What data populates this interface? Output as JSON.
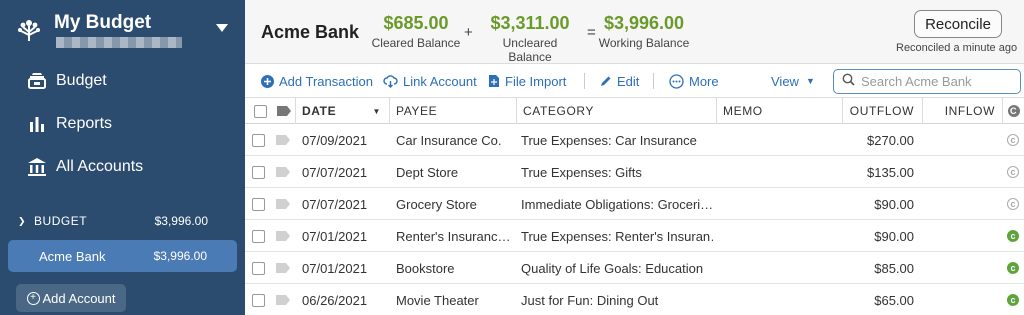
{
  "sidebar": {
    "budget_name": "My Budget",
    "nav": [
      {
        "label": "Budget",
        "icon": "wallet-icon"
      },
      {
        "label": "Reports",
        "icon": "bar-chart-icon"
      },
      {
        "label": "All Accounts",
        "icon": "bank-icon"
      }
    ],
    "group": {
      "label": "BUDGET",
      "amount": "$3,996.00"
    },
    "account": {
      "name": "Acme Bank",
      "amount": "$3,996.00"
    },
    "add_account_label": "Add Account"
  },
  "header": {
    "account_name": "Acme Bank",
    "cleared": {
      "value": "$685.00",
      "label": "Cleared Balance"
    },
    "uncleared": {
      "value": "$3,311.00",
      "label": "Uncleared Balance"
    },
    "working": {
      "value": "$3,996.00",
      "label": "Working Balance"
    },
    "plus": "+",
    "equals": "=",
    "reconcile_label": "Reconcile",
    "reconcile_note": "Reconciled a minute ago"
  },
  "toolbar": {
    "add_transaction": "Add Transaction",
    "link_account": "Link Account",
    "file_import": "File Import",
    "edit": "Edit",
    "more": "More",
    "view": "View",
    "search_placeholder": "Search Acme Bank"
  },
  "table": {
    "columns": {
      "date": "DATE",
      "payee": "PAYEE",
      "category": "CATEGORY",
      "memo": "MEMO",
      "outflow": "OUTFLOW",
      "inflow": "INFLOW",
      "cleared": "C"
    },
    "rows": [
      {
        "date": "07/09/2021",
        "payee": "Car Insurance Co.",
        "category": "True Expenses: Car Insurance",
        "memo": "",
        "outflow": "$270.00",
        "inflow": "",
        "cleared": "c"
      },
      {
        "date": "07/07/2021",
        "payee": "Dept Store",
        "category": "True Expenses: Gifts",
        "memo": "",
        "outflow": "$135.00",
        "inflow": "",
        "cleared": "c"
      },
      {
        "date": "07/07/2021",
        "payee": "Grocery Store",
        "category": "Immediate Obligations: Groceri…",
        "memo": "",
        "outflow": "$90.00",
        "inflow": "",
        "cleared": "c"
      },
      {
        "date": "07/01/2021",
        "payee": "Renter's Insuranc…",
        "category": "True Expenses: Renter's Insuran…",
        "memo": "",
        "outflow": "$90.00",
        "inflow": "",
        "cleared": "u"
      },
      {
        "date": "07/01/2021",
        "payee": "Bookstore",
        "category": "Quality of Life Goals: Education",
        "memo": "",
        "outflow": "$85.00",
        "inflow": "",
        "cleared": "u"
      },
      {
        "date": "06/26/2021",
        "payee": "Movie Theater",
        "category": "Just for Fun: Dining Out",
        "memo": "",
        "outflow": "$65.00",
        "inflow": "",
        "cleared": "u"
      }
    ]
  }
}
